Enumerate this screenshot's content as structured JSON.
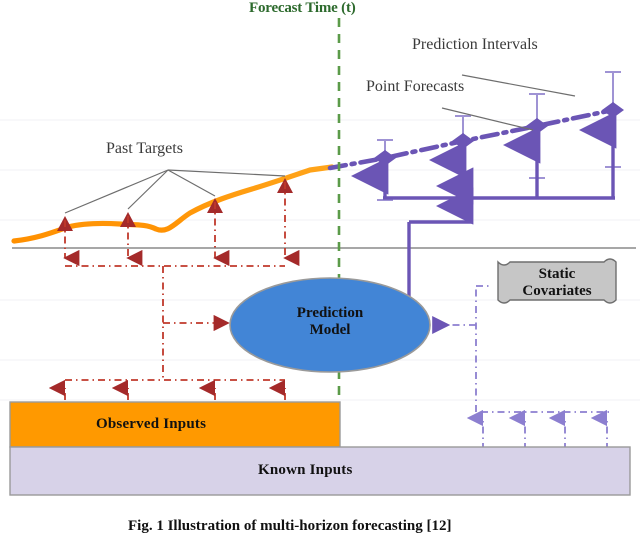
{
  "figure": {
    "caption": "Fig. 1 Illustration of multi-horizon forecasting [12]",
    "forecast_time_label": "Forecast Time (t)",
    "annotations": {
      "past_targets": "Past Targets",
      "point_forecasts": "Point Forecasts",
      "prediction_intervals": "Prediction Intervals"
    },
    "nodes": {
      "model_line1": "Prediction",
      "model_line2": "Model",
      "static_line1": "Static",
      "static_line2": "Covariates",
      "observed_inputs": "Observed Inputs",
      "known_inputs": "Known Inputs"
    },
    "colors": {
      "forecast_line": "#5b9b49",
      "past_series": "#FF9900",
      "observed_bar": "#FF9900",
      "known_bar": "#D7D2E8",
      "model_ellipse": "#4285d6",
      "static_box": "#C6C6C6",
      "past_flow": "#A42A2A",
      "forecast_flow": "#6B55B5",
      "known_flow": "#8C7FD0",
      "axis": "#8a8a8a",
      "leader": "#6e6e6e"
    }
  },
  "chart_data": {
    "type": "line",
    "title": "Illustration of multi-horizon forecasting",
    "xlabel": "",
    "ylabel": "",
    "grid": false,
    "legend": "none",
    "forecast_time_x": 330,
    "series": [
      {
        "name": "Past Targets",
        "style": "solid",
        "color": "#FF9900",
        "x": [
          14,
          40,
          68,
          95,
          120,
          145,
          160,
          180,
          210,
          240,
          270,
          300,
          330
        ],
        "y": [
          240,
          236,
          228,
          224,
          224,
          223,
          229,
          220,
          205,
          197,
          186,
          172,
          168
        ]
      },
      {
        "name": "Point Forecasts",
        "style": "dash-dot",
        "color": "#6B55B5",
        "x": [
          330,
          385,
          463,
          537,
          613
        ],
        "y": [
          168,
          158,
          141,
          126,
          110
        ]
      }
    ],
    "observed_markers_x": [
      65,
      128,
      215,
      285
    ],
    "point_forecast_markers": [
      {
        "x": 385,
        "y": 158,
        "interval_low": 175,
        "interval_high": 140
      },
      {
        "x": 463,
        "y": 141,
        "interval_low": 160,
        "interval_high": 116
      },
      {
        "x": 537,
        "y": 126,
        "interval_low": 150,
        "interval_high": 94
      },
      {
        "x": 613,
        "y": 110,
        "interval_low": 140,
        "interval_high": 72
      }
    ],
    "known_input_markers_x": [
      483,
      525,
      565,
      607
    ]
  }
}
